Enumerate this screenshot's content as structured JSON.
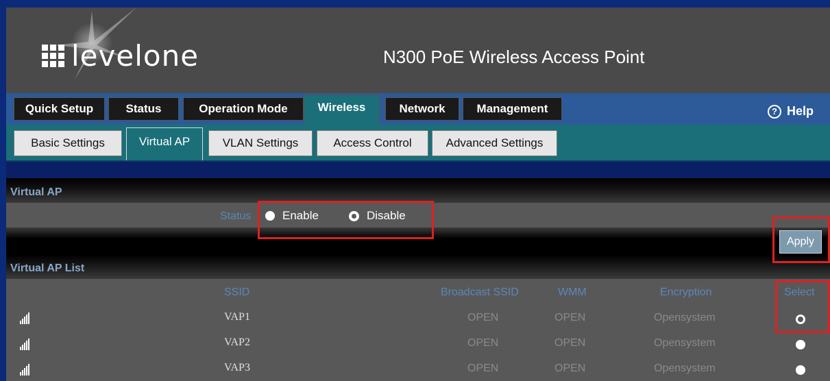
{
  "brand": {
    "logo_text": "levelone",
    "device_title": "N300 PoE Wireless Access Point"
  },
  "nav": {
    "tabs": [
      "Quick Setup",
      "Status",
      "Operation Mode",
      "Wireless",
      "Network",
      "Management"
    ],
    "active": "Wireless",
    "help_label": "Help"
  },
  "subnav": {
    "tabs": [
      "Basic Settings",
      "Virtual AP",
      "VLAN Settings",
      "Access Control",
      "Advanced Settings"
    ],
    "active": "Virtual AP"
  },
  "virtual_ap": {
    "section_title": "Virtual AP",
    "status_label": "Status",
    "options": [
      "Enable",
      "Disable"
    ],
    "selected": "Disable",
    "apply_label": "Apply"
  },
  "vap_list": {
    "section_title": "Virtual AP List",
    "columns": [
      "SSID",
      "Broadcast SSID",
      "WMM",
      "Encryption",
      "Select"
    ],
    "rows": [
      {
        "ssid": "VAP1",
        "broadcast": "OPEN",
        "wmm": "OPEN",
        "encryption": "Opensystem",
        "selected": true
      },
      {
        "ssid": "VAP2",
        "broadcast": "OPEN",
        "wmm": "OPEN",
        "encryption": "Opensystem",
        "selected": false
      },
      {
        "ssid": "VAP3",
        "broadcast": "OPEN",
        "wmm": "OPEN",
        "encryption": "Opensystem",
        "selected": false
      }
    ]
  },
  "icons": [
    "levelone-logo-icon",
    "help-icon",
    "signal-icon",
    "radio-icon"
  ],
  "colors": {
    "accent_teal": "#1a6f78",
    "nav_blue": "#2d5a99",
    "label_blue": "#5c86ba",
    "highlight_red": "#e02020"
  }
}
